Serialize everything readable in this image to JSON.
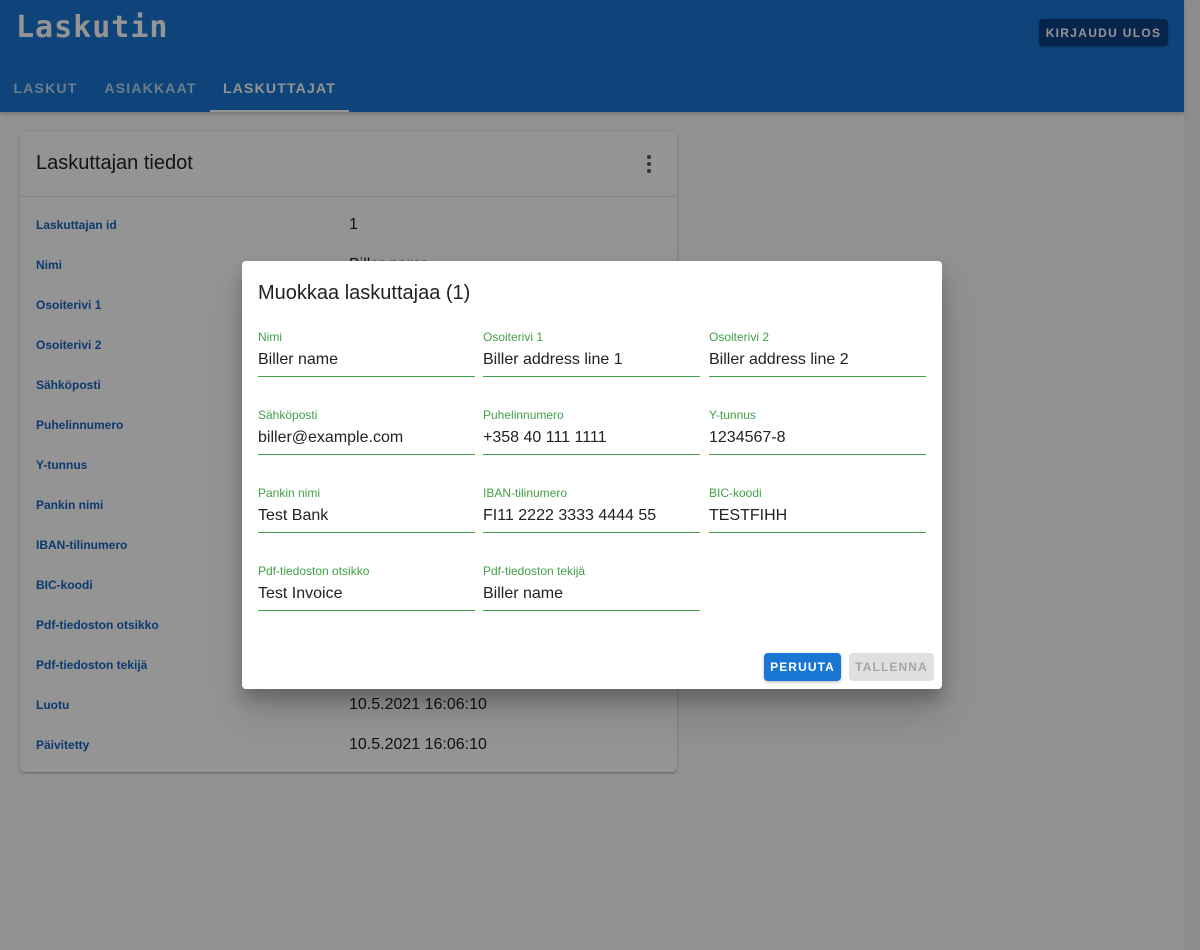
{
  "app": {
    "title": "Laskutin",
    "logout_label": "KIRJAUDU ULOS",
    "accent_color": "#1976d2"
  },
  "tabs": [
    {
      "label": "LASKUT",
      "active": false
    },
    {
      "label": "ASIAKKAAT",
      "active": false
    },
    {
      "label": "LASKUTTAJAT",
      "active": true
    }
  ],
  "card": {
    "title": "Laskuttajan tiedot",
    "menu_icon": "more-vert-icon",
    "rows": [
      {
        "label": "Laskuttajan id",
        "value": "1"
      },
      {
        "label": "Nimi",
        "value": "Biller name"
      },
      {
        "label": "Osoiterivi 1",
        "value": ""
      },
      {
        "label": "Osoiterivi 2",
        "value": ""
      },
      {
        "label": "Sähköposti",
        "value": ""
      },
      {
        "label": "Puhelinnumero",
        "value": ""
      },
      {
        "label": "Y-tunnus",
        "value": ""
      },
      {
        "label": "Pankin nimi",
        "value": ""
      },
      {
        "label": "IBAN-tilinumero",
        "value": ""
      },
      {
        "label": "BIC-koodi",
        "value": ""
      },
      {
        "label": "Pdf-tiedoston otsikko",
        "value": ""
      },
      {
        "label": "Pdf-tiedoston tekijä",
        "value": ""
      },
      {
        "label": "Luotu",
        "value": "10.5.2021 16:06:10"
      },
      {
        "label": "Päivitetty",
        "value": "10.5.2021 16:06:10"
      }
    ]
  },
  "dialog": {
    "title": "Muokkaa laskuttajaa (1)",
    "fields": [
      {
        "label": "Nimi",
        "value": "Biller name"
      },
      {
        "label": "Osoiterivi 1",
        "value": "Biller address line 1"
      },
      {
        "label": "Osoiterivi 2",
        "value": "Biller address line 2"
      },
      {
        "label": "Sähköposti",
        "value": "biller@example.com"
      },
      {
        "label": "Puhelinnumero",
        "value": "+358 40 111 1111"
      },
      {
        "label": "Y-tunnus",
        "value": "1234567-8"
      },
      {
        "label": "Pankin nimi",
        "value": "Test Bank"
      },
      {
        "label": "IBAN-tilinumero",
        "value": "FI11 2222 3333 4444 55"
      },
      {
        "label": "BIC-koodi",
        "value": "TESTFIHH"
      },
      {
        "label": "Pdf-tiedoston otsikko",
        "value": "Test Invoice"
      },
      {
        "label": "Pdf-tiedoston tekijä",
        "value": "Biller name"
      }
    ],
    "cancel_label": "PERUUTA",
    "save_label": "TALLENNA"
  }
}
